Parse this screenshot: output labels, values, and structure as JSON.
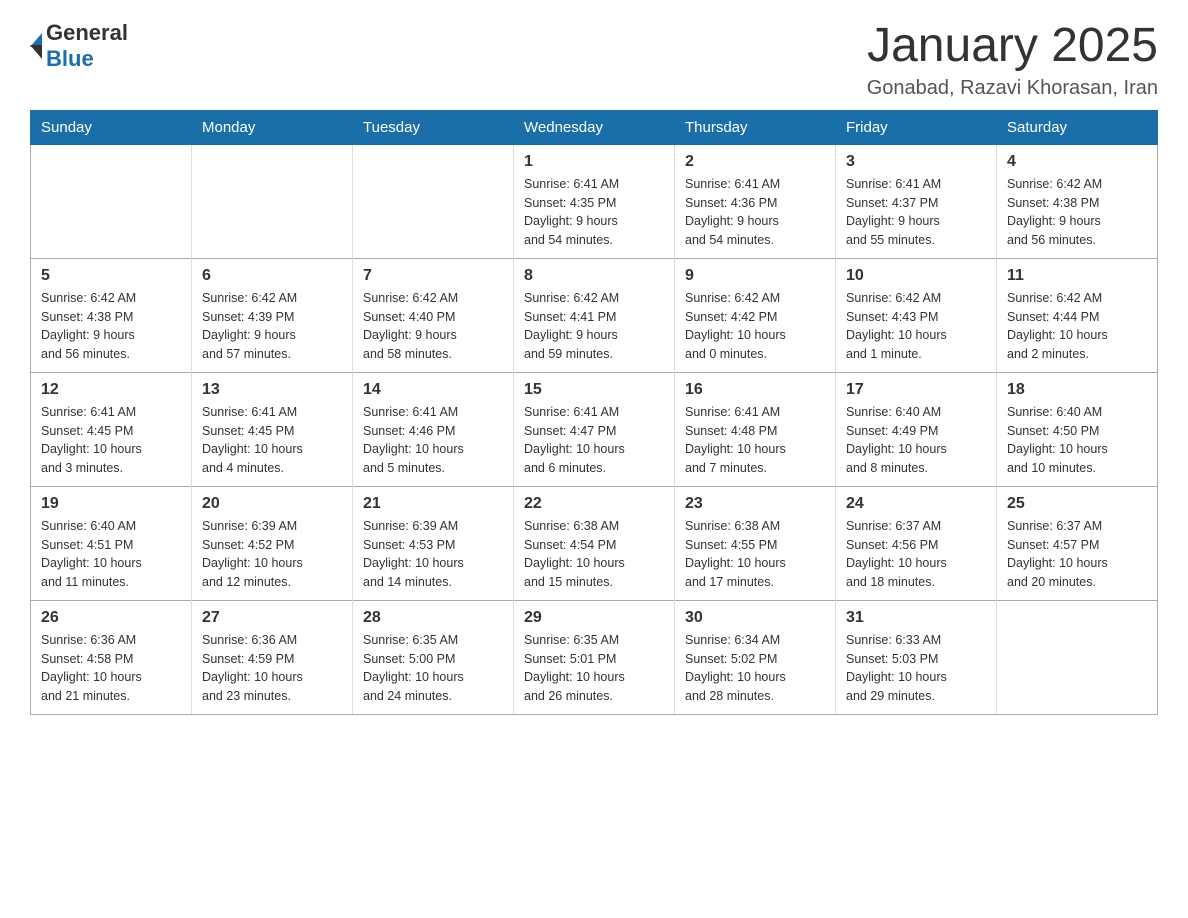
{
  "header": {
    "logo": {
      "text1": "General",
      "text2": "Blue"
    },
    "title": "January 2025",
    "subtitle": "Gonabad, Razavi Khorasan, Iran"
  },
  "calendar": {
    "days_of_week": [
      "Sunday",
      "Monday",
      "Tuesday",
      "Wednesday",
      "Thursday",
      "Friday",
      "Saturday"
    ],
    "weeks": [
      [
        {
          "day": "",
          "info": ""
        },
        {
          "day": "",
          "info": ""
        },
        {
          "day": "",
          "info": ""
        },
        {
          "day": "1",
          "info": "Sunrise: 6:41 AM\nSunset: 4:35 PM\nDaylight: 9 hours\nand 54 minutes."
        },
        {
          "day": "2",
          "info": "Sunrise: 6:41 AM\nSunset: 4:36 PM\nDaylight: 9 hours\nand 54 minutes."
        },
        {
          "day": "3",
          "info": "Sunrise: 6:41 AM\nSunset: 4:37 PM\nDaylight: 9 hours\nand 55 minutes."
        },
        {
          "day": "4",
          "info": "Sunrise: 6:42 AM\nSunset: 4:38 PM\nDaylight: 9 hours\nand 56 minutes."
        }
      ],
      [
        {
          "day": "5",
          "info": "Sunrise: 6:42 AM\nSunset: 4:38 PM\nDaylight: 9 hours\nand 56 minutes."
        },
        {
          "day": "6",
          "info": "Sunrise: 6:42 AM\nSunset: 4:39 PM\nDaylight: 9 hours\nand 57 minutes."
        },
        {
          "day": "7",
          "info": "Sunrise: 6:42 AM\nSunset: 4:40 PM\nDaylight: 9 hours\nand 58 minutes."
        },
        {
          "day": "8",
          "info": "Sunrise: 6:42 AM\nSunset: 4:41 PM\nDaylight: 9 hours\nand 59 minutes."
        },
        {
          "day": "9",
          "info": "Sunrise: 6:42 AM\nSunset: 4:42 PM\nDaylight: 10 hours\nand 0 minutes."
        },
        {
          "day": "10",
          "info": "Sunrise: 6:42 AM\nSunset: 4:43 PM\nDaylight: 10 hours\nand 1 minute."
        },
        {
          "day": "11",
          "info": "Sunrise: 6:42 AM\nSunset: 4:44 PM\nDaylight: 10 hours\nand 2 minutes."
        }
      ],
      [
        {
          "day": "12",
          "info": "Sunrise: 6:41 AM\nSunset: 4:45 PM\nDaylight: 10 hours\nand 3 minutes."
        },
        {
          "day": "13",
          "info": "Sunrise: 6:41 AM\nSunset: 4:45 PM\nDaylight: 10 hours\nand 4 minutes."
        },
        {
          "day": "14",
          "info": "Sunrise: 6:41 AM\nSunset: 4:46 PM\nDaylight: 10 hours\nand 5 minutes."
        },
        {
          "day": "15",
          "info": "Sunrise: 6:41 AM\nSunset: 4:47 PM\nDaylight: 10 hours\nand 6 minutes."
        },
        {
          "day": "16",
          "info": "Sunrise: 6:41 AM\nSunset: 4:48 PM\nDaylight: 10 hours\nand 7 minutes."
        },
        {
          "day": "17",
          "info": "Sunrise: 6:40 AM\nSunset: 4:49 PM\nDaylight: 10 hours\nand 8 minutes."
        },
        {
          "day": "18",
          "info": "Sunrise: 6:40 AM\nSunset: 4:50 PM\nDaylight: 10 hours\nand 10 minutes."
        }
      ],
      [
        {
          "day": "19",
          "info": "Sunrise: 6:40 AM\nSunset: 4:51 PM\nDaylight: 10 hours\nand 11 minutes."
        },
        {
          "day": "20",
          "info": "Sunrise: 6:39 AM\nSunset: 4:52 PM\nDaylight: 10 hours\nand 12 minutes."
        },
        {
          "day": "21",
          "info": "Sunrise: 6:39 AM\nSunset: 4:53 PM\nDaylight: 10 hours\nand 14 minutes."
        },
        {
          "day": "22",
          "info": "Sunrise: 6:38 AM\nSunset: 4:54 PM\nDaylight: 10 hours\nand 15 minutes."
        },
        {
          "day": "23",
          "info": "Sunrise: 6:38 AM\nSunset: 4:55 PM\nDaylight: 10 hours\nand 17 minutes."
        },
        {
          "day": "24",
          "info": "Sunrise: 6:37 AM\nSunset: 4:56 PM\nDaylight: 10 hours\nand 18 minutes."
        },
        {
          "day": "25",
          "info": "Sunrise: 6:37 AM\nSunset: 4:57 PM\nDaylight: 10 hours\nand 20 minutes."
        }
      ],
      [
        {
          "day": "26",
          "info": "Sunrise: 6:36 AM\nSunset: 4:58 PM\nDaylight: 10 hours\nand 21 minutes."
        },
        {
          "day": "27",
          "info": "Sunrise: 6:36 AM\nSunset: 4:59 PM\nDaylight: 10 hours\nand 23 minutes."
        },
        {
          "day": "28",
          "info": "Sunrise: 6:35 AM\nSunset: 5:00 PM\nDaylight: 10 hours\nand 24 minutes."
        },
        {
          "day": "29",
          "info": "Sunrise: 6:35 AM\nSunset: 5:01 PM\nDaylight: 10 hours\nand 26 minutes."
        },
        {
          "day": "30",
          "info": "Sunrise: 6:34 AM\nSunset: 5:02 PM\nDaylight: 10 hours\nand 28 minutes."
        },
        {
          "day": "31",
          "info": "Sunrise: 6:33 AM\nSunset: 5:03 PM\nDaylight: 10 hours\nand 29 minutes."
        },
        {
          "day": "",
          "info": ""
        }
      ]
    ]
  }
}
